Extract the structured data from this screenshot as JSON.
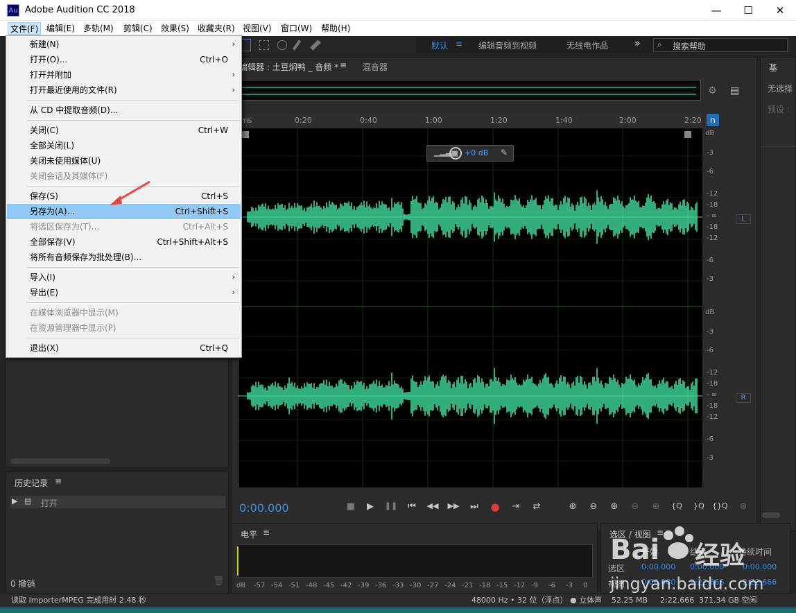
{
  "window": {
    "logo": "Au",
    "title": "Adobe Audition CC 2018",
    "min": "—",
    "max": "☐",
    "close": "✕"
  },
  "menubar": [
    "文件(F)",
    "编辑(E)",
    "多轨(M)",
    "剪辑(C)",
    "效果(S)",
    "收藏夹(R)",
    "视图(V)",
    "窗口(W)",
    "帮助(H)"
  ],
  "workspace": {
    "active": "默认",
    "menu_icon": "≡",
    "items": [
      "编辑音频到视频",
      "无线电作品"
    ],
    "more": "»",
    "search_placeholder": "搜索帮助"
  },
  "editor": {
    "tab": "编辑器 : 土豆焖鸭 _ 音频 *",
    "tab_menu": "≡",
    "mixer_tab": "混音器"
  },
  "ruler": {
    "unit": "ms",
    "ticks": [
      "0:20",
      "0:40",
      "1:00",
      "1:20",
      "1:40",
      "2:00",
      "2:20"
    ]
  },
  "hud": {
    "gain": "+0 dB"
  },
  "db_scale_L": [
    "dB",
    "-3",
    "-6",
    "-12",
    "-18",
    "- ∞",
    "-18",
    "-12",
    "-6",
    "-3"
  ],
  "db_scale_R": [
    "dB",
    "-3",
    "-6",
    "-12",
    "-18",
    "- ∞",
    "-18",
    "-12",
    "-6",
    "-3"
  ],
  "channels": {
    "left": "L",
    "right": "R"
  },
  "transport": {
    "time": "0:00.000",
    "buttons": [
      "■",
      "▶",
      "❚❚",
      "⏮",
      "◀◀",
      "▶▶",
      "⏭",
      "●",
      "⇥",
      "⇄"
    ],
    "zoom": [
      "⊕",
      "⊖",
      "⊕",
      "⊖",
      "⊕",
      "{Q",
      "}Q",
      "{}Q",
      "⊕"
    ]
  },
  "right_panel": {
    "tab": "基",
    "none_selected": "无选择",
    "preset": "预设 :"
  },
  "history": {
    "title": "历史记录",
    "menu": "≡",
    "item": "打开",
    "undo": "0 撤销"
  },
  "level": {
    "title": "电平",
    "menu": "≡",
    "scale": [
      "dB",
      "-57",
      "-54",
      "-51",
      "-48",
      "-45",
      "-42",
      "-39",
      "-36",
      "-33",
      "-30",
      "-27",
      "-24",
      "-21",
      "-18",
      "-15",
      "-12",
      "-9",
      "-6",
      "-3",
      "0"
    ]
  },
  "selection": {
    "title": "选区 / 视图",
    "menu": "≡",
    "col_start": "开始",
    "col_end": "结束",
    "col_duration": "持续时间",
    "row_sel": "选区",
    "row_view": "视图",
    "sel_start": "0:00.000",
    "sel_end": "0:00.000",
    "sel_dur": "0:00.000",
    "view_start": "0:00.000",
    "view_end": "2:22.666",
    "view_dur": "2:22.666"
  },
  "status": {
    "left": "读取 ImporterMPEG 完成用时 2.48 秒",
    "format": "48000 Hz • 32 位（浮点） ● 立体声",
    "size": "52.25 MB",
    "duration": "2:22.666",
    "free": "371.34 GB 空闲"
  },
  "dropdown": [
    {
      "label": "新建(N)",
      "shortcut": "",
      "arrow": true,
      "disabled": false
    },
    {
      "label": "打开(O)...",
      "shortcut": "Ctrl+O",
      "arrow": false,
      "disabled": false
    },
    {
      "label": "打开并附加",
      "shortcut": "",
      "arrow": true,
      "disabled": false
    },
    {
      "label": "打开最近使用的文件(R)",
      "shortcut": "",
      "arrow": true,
      "disabled": false
    },
    {
      "label": "从 CD 中提取音频(D)...",
      "shortcut": "",
      "arrow": false,
      "disabled": false
    },
    {
      "label": "关闭(C)",
      "shortcut": "Ctrl+W",
      "arrow": false,
      "disabled": false
    },
    {
      "label": "全部关闭(L)",
      "shortcut": "",
      "arrow": false,
      "disabled": false
    },
    {
      "label": "关闭未使用媒体(U)",
      "shortcut": "",
      "arrow": false,
      "disabled": false
    },
    {
      "label": "关闭会话及其媒体(F)",
      "shortcut": "",
      "arrow": false,
      "disabled": true
    },
    {
      "label": "保存(S)",
      "shortcut": "Ctrl+S",
      "arrow": false,
      "disabled": false
    },
    {
      "label": "另存为(A)...",
      "shortcut": "Ctrl+Shift+S",
      "arrow": false,
      "disabled": false
    },
    {
      "label": "将选区保存为(T)...",
      "shortcut": "Ctrl+Alt+S",
      "arrow": false,
      "disabled": true
    },
    {
      "label": "全部保存(V)",
      "shortcut": "Ctrl+Shift+Alt+S",
      "arrow": false,
      "disabled": false
    },
    {
      "label": "将所有音频保存为批处理(B)...",
      "shortcut": "",
      "arrow": false,
      "disabled": false
    },
    {
      "label": "导入(I)",
      "shortcut": "",
      "arrow": true,
      "disabled": false
    },
    {
      "label": "导出(E)",
      "shortcut": "",
      "arrow": true,
      "disabled": false
    },
    {
      "label": "在媒体浏览器中显示(M)",
      "shortcut": "",
      "arrow": false,
      "disabled": true
    },
    {
      "label": "在资源管理器中显示(P)",
      "shortcut": "",
      "arrow": false,
      "disabled": true
    },
    {
      "label": "退出(X)",
      "shortcut": "Ctrl+Q",
      "arrow": false,
      "disabled": false
    }
  ],
  "watermark": {
    "brand": "Bai",
    "brand2": "经验",
    "url": "jingyan.baidu.com"
  },
  "colors": {
    "waveform": "#3fd99b",
    "accent": "#2d8ceb",
    "highlight": "#91c9f7",
    "arrow": "#e8453c"
  }
}
